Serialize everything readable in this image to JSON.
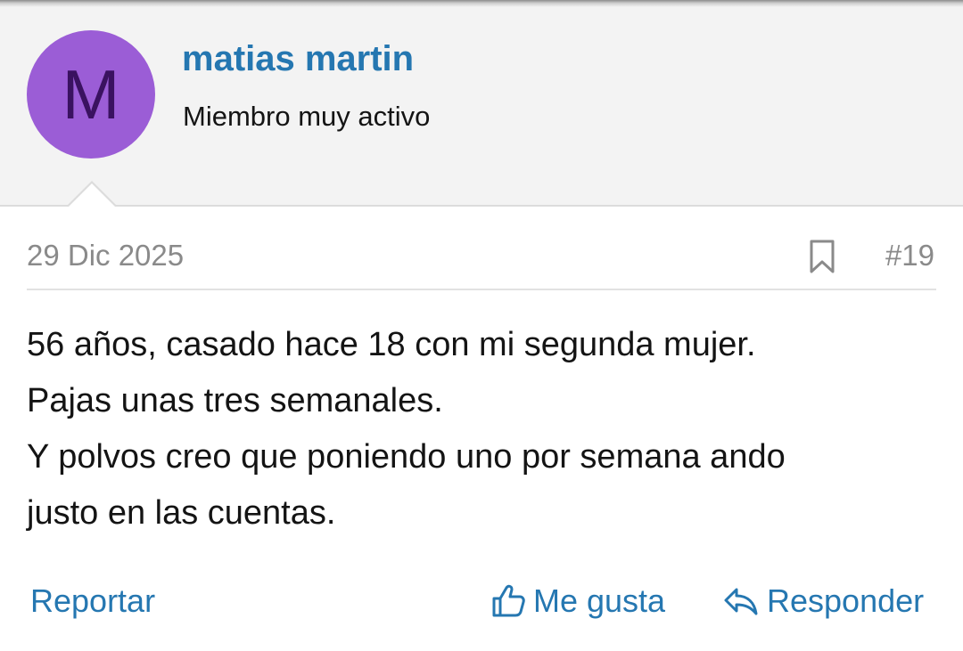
{
  "user": {
    "avatar_letter": "M",
    "avatar_color": "#9b5dd6",
    "name": "matias martin",
    "title": "Miembro muy activo"
  },
  "post": {
    "date": "29 Dic 2025",
    "number": "#19",
    "body_lines": [
      "56 años, casado hace 18 con mi segunda mujer.",
      "Pajas unas tres semanales.",
      "Y polvos creo que poniendo uno por semana ando",
      "justo en las cuentas."
    ]
  },
  "actions": {
    "report_label": "Reportar",
    "like_label": "Me gusta",
    "reply_label": "Responder"
  },
  "icons": {
    "bookmark": "bookmark-icon",
    "like": "thumbs-up-icon",
    "reply": "reply-arrow-icon"
  },
  "colors": {
    "link": "#2577b1",
    "header_bg": "#f3f3f3",
    "muted_text": "#8a8a8a"
  }
}
